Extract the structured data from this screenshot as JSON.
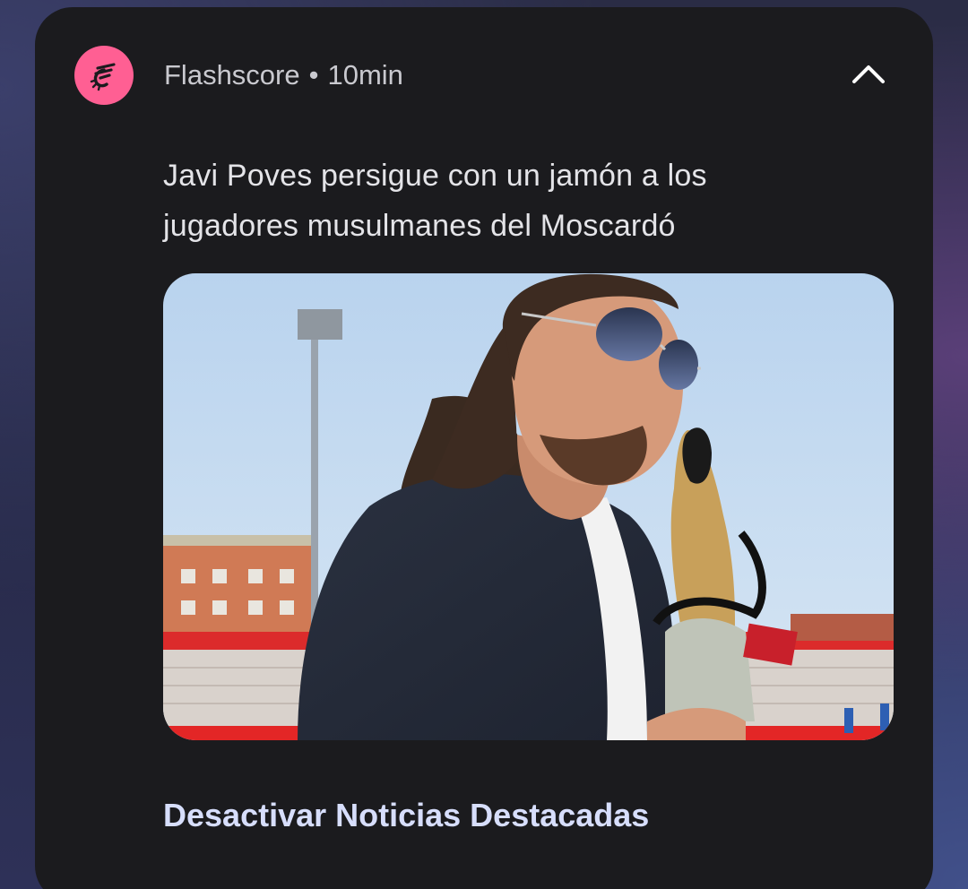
{
  "notification": {
    "app_name": "Flashscore",
    "separator": "•",
    "time": "10min",
    "title_lines": [
      "Javi Poves persigue con un jamón a los",
      "jugadores musulmanes del Moscardó"
    ],
    "action_label": "Desactivar Noticias Destacadas",
    "icons": {
      "app": "flashscore-logo-icon",
      "collapse": "chevron-up-icon"
    },
    "colors": {
      "card_background": "#1b1b1e",
      "app_icon": "#ff5f93",
      "action_text": "#d7defc"
    }
  }
}
